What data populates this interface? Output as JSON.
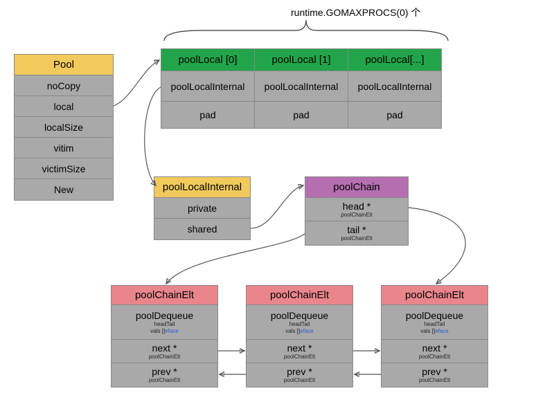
{
  "title_note": "runtime.GOMAXPROCS(0) 个",
  "pool": {
    "header": "Pool",
    "fields": [
      "noCopy",
      "local",
      "localSize",
      "vitim",
      "victimSize",
      "New"
    ]
  },
  "poolLocal": {
    "cols": [
      {
        "head": "poolLocal [0]",
        "r1": "poolLocalInternal",
        "r2": "pad"
      },
      {
        "head": "poolLocal [1]",
        "r1": "poolLocalInternal",
        "r2": "pad"
      },
      {
        "head": "poolLocal[...]",
        "r1": "poolLocalInternal",
        "r2": "pad"
      }
    ]
  },
  "poolLocalInternal": {
    "header": "poolLocalInternal",
    "fields": [
      "private",
      "shared"
    ]
  },
  "poolChain": {
    "header": "poolChain",
    "rows": [
      {
        "label": "head *",
        "sub": "poolChainElt"
      },
      {
        "label": "tail *",
        "sub": "poolChainElt"
      }
    ]
  },
  "poolChainElt": {
    "header": "poolChainElt",
    "dequeue": "poolDequeue",
    "dqSub1": "headTail",
    "dqSub2a": "vals []",
    "dqSub2b": "eface",
    "next": {
      "label": "next *",
      "sub": "poolChainElt"
    },
    "prev": {
      "label": "prev *",
      "sub": "poolChainElt"
    }
  }
}
